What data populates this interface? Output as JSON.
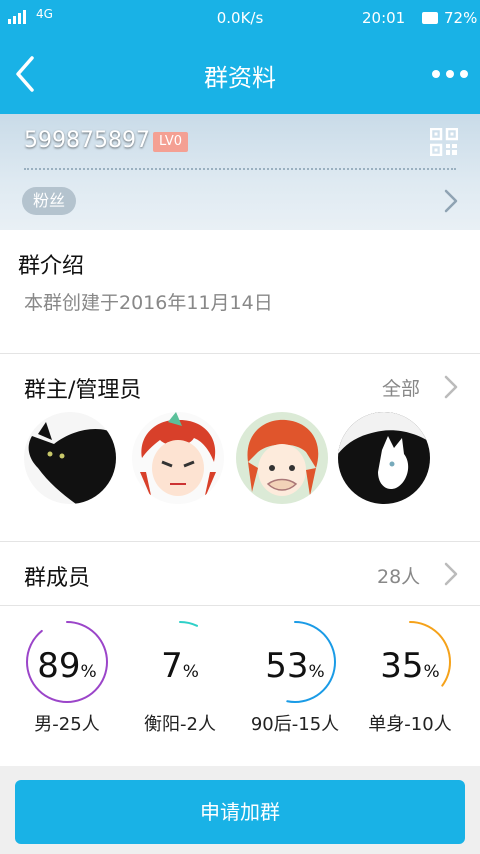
{
  "status_bar": {
    "network": "4G",
    "speed": "0.0K/s",
    "time": "20:01",
    "battery": "72%",
    "signal_icon": "signal-bars-icon",
    "battery_icon": "battery-icon"
  },
  "nav": {
    "title": "群资料",
    "back_icon": "chevron-left-icon",
    "more_icon": "more-dots-icon",
    "bg_color": "#19b2e6"
  },
  "group": {
    "id": "599875897",
    "level": "LV0",
    "fans_label": "粉丝",
    "qr_icon": "qr-code-icon"
  },
  "intro": {
    "heading": "群介绍",
    "text": "本群创建于2016年11月14日"
  },
  "admins": {
    "heading": "群主/管理员",
    "all_label": "全部",
    "avatars": [
      "black-cat-avatar",
      "red-hair-anime-avatar",
      "red-hair-girl-avatar",
      "white-cat-avatar"
    ]
  },
  "members": {
    "heading": "群成员",
    "count": "28人"
  },
  "stats": [
    {
      "value": "89",
      "unit": "%",
      "label": "男-25人",
      "ring_fraction": 0.89,
      "color": "#9b45c9"
    },
    {
      "value": "7",
      "unit": "%",
      "label": "衡阳-2人",
      "ring_fraction": 0.07,
      "color": "#2fd0c8"
    },
    {
      "value": "53",
      "unit": "%",
      "label": "90后-15人",
      "ring_fraction": 0.53,
      "color": "#1a9be6"
    },
    {
      "value": "35",
      "unit": "%",
      "label": "单身-10人",
      "ring_fraction": 0.35,
      "color": "#f5a21a"
    }
  ],
  "join_button": "申请加群"
}
